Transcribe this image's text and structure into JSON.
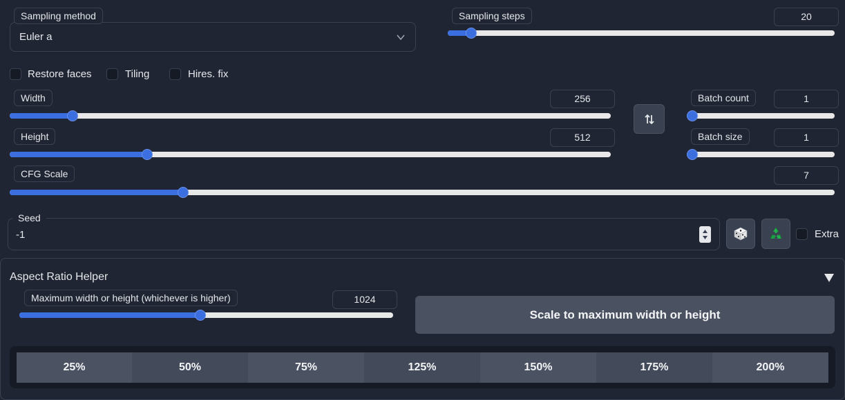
{
  "sampling": {
    "method_label": "Sampling method",
    "method_value": "Euler a",
    "steps_label": "Sampling steps",
    "steps_value": "20",
    "steps_fraction": 0.06
  },
  "checkboxes": {
    "restore_faces": "Restore faces",
    "tiling": "Tiling",
    "hires_fix": "Hires. fix"
  },
  "dimensions": {
    "width_label": "Width",
    "width_value": "256",
    "width_fraction": 0.105,
    "height_label": "Height",
    "height_value": "512",
    "height_fraction": 0.229
  },
  "batch": {
    "count_label": "Batch count",
    "count_value": "1",
    "size_label": "Batch size",
    "size_value": "1"
  },
  "cfg": {
    "label": "CFG Scale",
    "value": "7",
    "fraction": 0.21
  },
  "seed": {
    "label": "Seed",
    "value": "-1",
    "extra_label": "Extra"
  },
  "aspect": {
    "title": "Aspect Ratio Helper",
    "max_label": "Maximum width or height (whichever is higher)",
    "max_value": "1024",
    "max_fraction": 0.485,
    "scale_button": "Scale to maximum width or height",
    "percents": [
      "25%",
      "50%",
      "75%",
      "125%",
      "150%",
      "175%",
      "200%"
    ]
  },
  "colors": {
    "accent": "#3b6fe0",
    "background": "#1f2533",
    "button": "#3a4150"
  }
}
